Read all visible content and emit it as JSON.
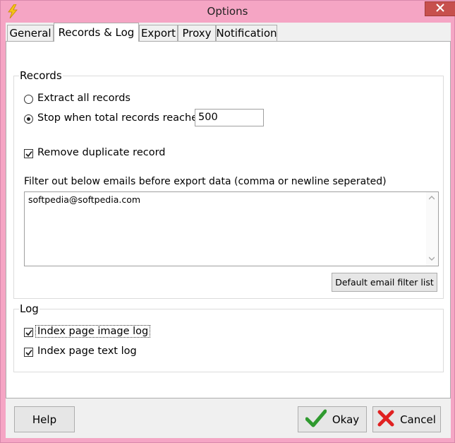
{
  "window": {
    "title": "Options"
  },
  "tabs": [
    {
      "label": "General",
      "active": false
    },
    {
      "label": "Records & Log",
      "active": true
    },
    {
      "label": "Export",
      "active": false
    },
    {
      "label": "Proxy",
      "active": false
    },
    {
      "label": "Notification",
      "active": false
    }
  ],
  "records": {
    "group_label": "Records",
    "extract_all_label": "Extract all records",
    "extract_all_selected": false,
    "stop_when_label": "Stop when total records reaches",
    "stop_when_selected": true,
    "stop_value": "500",
    "remove_duplicate_label": "Remove duplicate record",
    "remove_duplicate_checked": true,
    "filter_label": "Filter out below emails before export data (comma or newline seperated)",
    "filter_text": "softpedia@softpedia.com",
    "default_filter_button": "Default email filter list"
  },
  "log": {
    "group_label": "Log",
    "image_log_label": "Index page image log",
    "image_log_checked": true,
    "text_log_label": "Index page text log",
    "text_log_checked": true
  },
  "buttons": {
    "help": "Help",
    "okay": "Okay",
    "cancel": "Cancel"
  },
  "colors": {
    "frame": "#f5a5c4",
    "close_button": "#c7504d",
    "ok_check": "#3aa83a",
    "cancel_x": "#e02020"
  }
}
